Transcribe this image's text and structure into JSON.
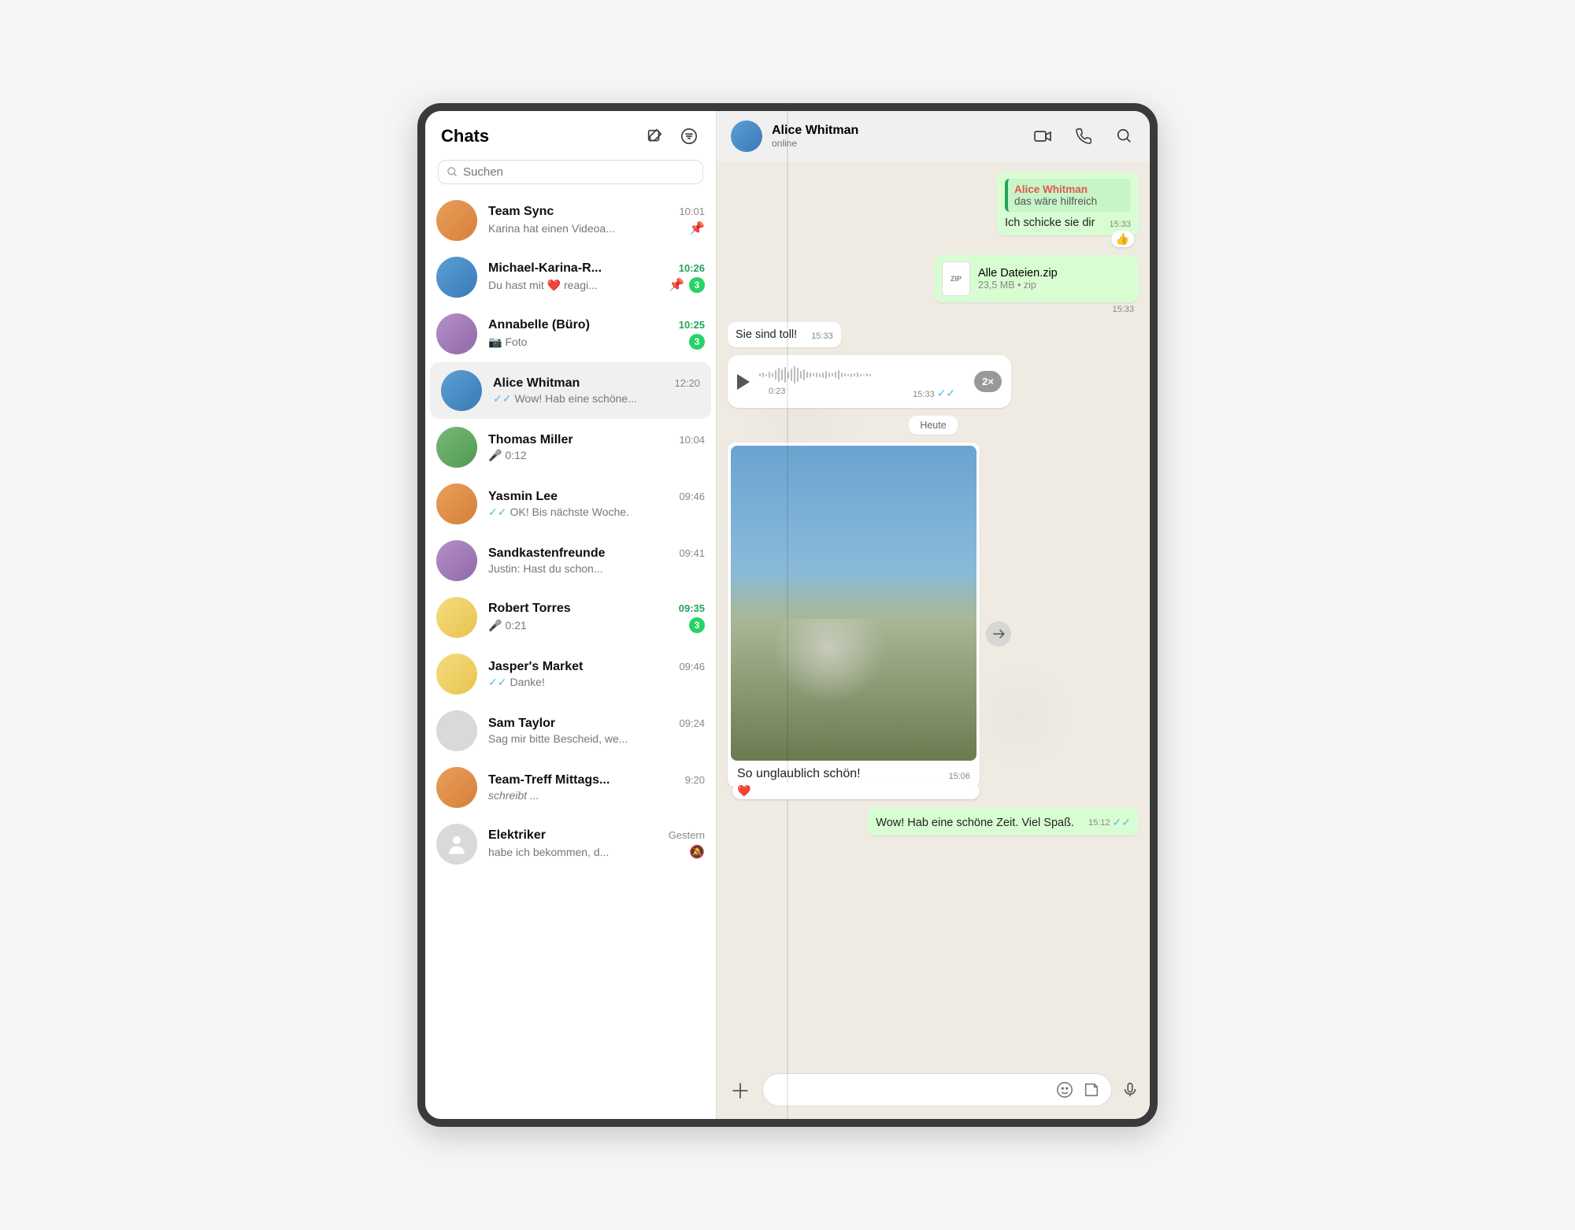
{
  "sidebar": {
    "title": "Chats",
    "search_placeholder": "Suchen",
    "items": [
      {
        "name": "Team Sync",
        "time": "10:01",
        "preview": "Karina hat einen Videoa...",
        "pinned": true,
        "tick": false,
        "badge": null,
        "avatar": "orange"
      },
      {
        "name": "Michael-Karina-R...",
        "time": "10:26",
        "preview": "Du hast mit ❤️ reagi...",
        "pinned": true,
        "tick": false,
        "badge": "3",
        "unread": true,
        "avatar": "blue"
      },
      {
        "name": "Annabelle (Büro)",
        "time": "10:25",
        "preview": "Foto",
        "photo": true,
        "tick": false,
        "badge": "3",
        "unread": true,
        "avatar": "purple"
      },
      {
        "name": "Alice Whitman",
        "time": "12:20",
        "preview": "Wow! Hab eine schöne...",
        "tick": true,
        "active": true,
        "avatar": "blue"
      },
      {
        "name": "Thomas Miller",
        "time": "10:04",
        "preview": "0:12",
        "voice": true,
        "avatar": "green"
      },
      {
        "name": "Yasmin Lee",
        "time": "09:46",
        "preview": "OK! Bis nächste Woche.",
        "tick": true,
        "avatar": "orange"
      },
      {
        "name": "Sandkastenfreunde",
        "time": "09:41",
        "preview": "Justin: Hast du schon...",
        "avatar": "purple"
      },
      {
        "name": "Robert Torres",
        "time": "09:35",
        "preview": "0:21",
        "voice": true,
        "voice_green": true,
        "badge": "3",
        "unread": true,
        "avatar": "yellow"
      },
      {
        "name": "Jasper's Market",
        "time": "09:46",
        "preview": "Danke!",
        "tick": true,
        "avatar": "yellow"
      },
      {
        "name": "Sam Taylor",
        "time": "09:24",
        "preview": "Sag mir bitte Bescheid, we...",
        "avatar": "gray"
      },
      {
        "name": "Team-Treff Mittags...",
        "time": "9:20",
        "preview": "schreibt ...",
        "typing": true,
        "avatar": "orange"
      },
      {
        "name": "Elektriker",
        "time": "Gestern",
        "preview": "habe ich bekommen, d...",
        "muted": true,
        "avatar": "gray",
        "silhouette": true
      }
    ]
  },
  "chat": {
    "header_name": "Alice Whitman",
    "header_status": "online",
    "reply_name": "Alice Whitman",
    "reply_text": "das wäre hilfreich",
    "msg1_text": "Ich schicke sie dir",
    "msg1_time": "15:33",
    "reaction1": "👍",
    "file_name": "Alle Dateien.zip",
    "file_meta": "23,5 MB • zip",
    "file_ext": "ZIP",
    "file_time": "15:33",
    "msg_in_text": "Sie sind toll!",
    "msg_in_time": "15:33",
    "voice_duration": "0:23",
    "voice_time": "15:33",
    "voice_speed": "2×",
    "date_label": "Heute",
    "image_caption": "So unglaublich schön!",
    "image_time": "15:06",
    "reaction2": "❤️",
    "msg_out_text": "Wow! Hab eine schöne Zeit. Viel Spaß.",
    "msg_out_time": "15:12"
  }
}
